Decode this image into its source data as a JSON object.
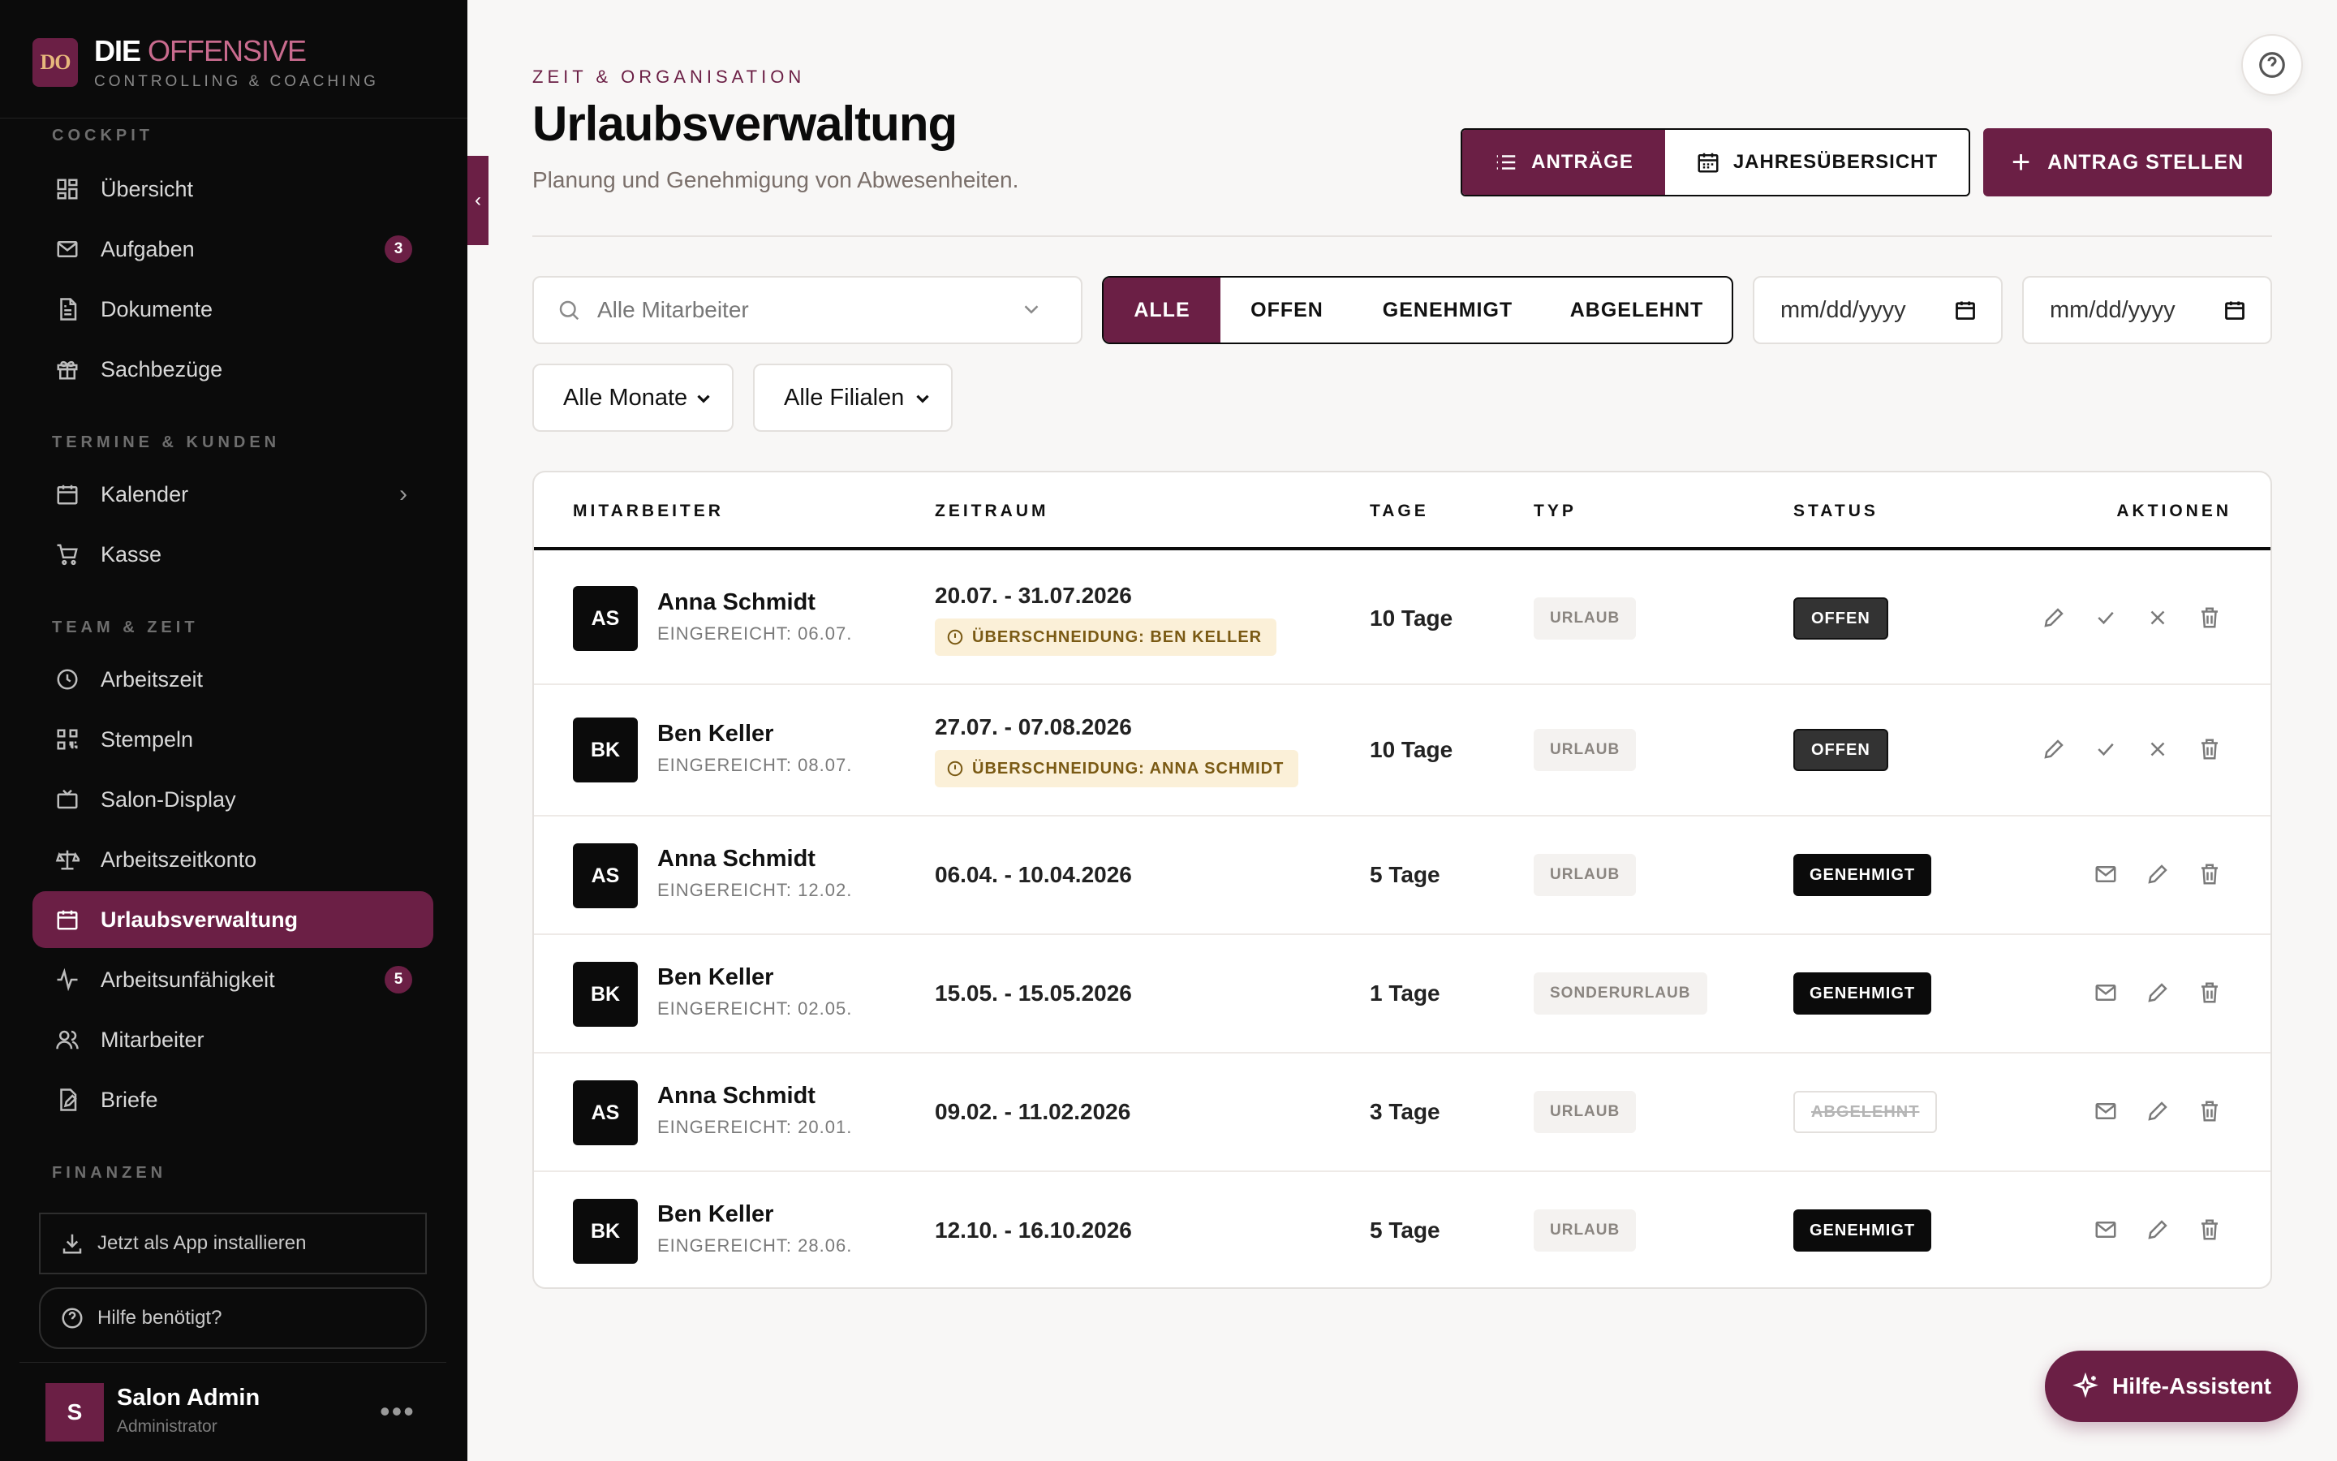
{
  "brand": {
    "logo": "DO",
    "name_part1": "DIE",
    "name_part2": "OFFENSIVE",
    "subtitle": "CONTROLLING & COACHING"
  },
  "sidebar": {
    "sections": [
      {
        "title": "COCKPIT"
      },
      {
        "title": "TERMINE & KUNDEN"
      },
      {
        "title": "TEAM & ZEIT"
      },
      {
        "title": "FINANZEN"
      }
    ],
    "items": [
      {
        "label": "Übersicht",
        "icon": "grid-icon"
      },
      {
        "label": "Aufgaben",
        "icon": "mail-icon",
        "badge": "3"
      },
      {
        "label": "Dokumente",
        "icon": "document-icon"
      },
      {
        "label": "Sachbezüge",
        "icon": "gift-icon"
      },
      {
        "label": "Kalender",
        "icon": "calendar-icon"
      },
      {
        "label": "Kasse",
        "icon": "cart-icon"
      },
      {
        "label": "Arbeitszeit",
        "icon": "clock-icon"
      },
      {
        "label": "Stempeln",
        "icon": "qr-icon"
      },
      {
        "label": "Salon-Display",
        "icon": "tv-icon"
      },
      {
        "label": "Arbeitszeitkonto",
        "icon": "scale-icon"
      },
      {
        "label": "Urlaubsverwaltung",
        "icon": "calendar-icon"
      },
      {
        "label": "Arbeitsunfähigkeit",
        "icon": "activity-icon",
        "badge": "5"
      },
      {
        "label": "Mitarbeiter",
        "icon": "users-icon"
      },
      {
        "label": "Briefe",
        "icon": "edit-icon"
      }
    ],
    "install_label": "Jetzt als App installieren",
    "help_label": "Hilfe benötigt?",
    "user": {
      "initial": "S",
      "name": "Salon Admin",
      "role": "Administrator",
      "more": "•••"
    }
  },
  "header": {
    "eyebrow": "ZEIT & ORGANISATION",
    "title": "Urlaubsverwaltung",
    "subtitle": "Planung und Genehmigung von Abwesenheiten.",
    "view_requests": "ANTRÄGE",
    "view_year": "JAHRESÜBERSICHT",
    "new_request": "ANTRAG STELLEN"
  },
  "filters": {
    "employee_placeholder": "Alle Mitarbeiter",
    "status_tabs": [
      "ALLE",
      "OFFEN",
      "GENEHMIGT",
      "ABGELEHNT"
    ],
    "date_from_placeholder": "mm/dd/yyyy",
    "date_to_placeholder": "mm/dd/yyyy",
    "month_select": "Alle Monate",
    "branch_select": "Alle Filialen"
  },
  "table": {
    "columns": [
      "MITARBEITER",
      "ZEITRAUM",
      "TAGE",
      "TYP",
      "STATUS",
      "AKTIONEN"
    ],
    "rows": [
      {
        "initials": "AS",
        "name": "Anna Schmidt",
        "submitted": "EINGEREICHT: 06.07.",
        "period": "20.07. - 31.07.2026",
        "overlap": "ÜBERSCHNEIDUNG: BEN KELLER",
        "days": "10 Tage",
        "type": "URLAUB",
        "status": "OFFEN"
      },
      {
        "initials": "BK",
        "name": "Ben Keller",
        "submitted": "EINGEREICHT: 08.07.",
        "period": "27.07. - 07.08.2026",
        "overlap": "ÜBERSCHNEIDUNG: ANNA SCHMIDT",
        "days": "10 Tage",
        "type": "URLAUB",
        "status": "OFFEN"
      },
      {
        "initials": "AS",
        "name": "Anna Schmidt",
        "submitted": "EINGEREICHT: 12.02.",
        "period": "06.04. - 10.04.2026",
        "days": "5 Tage",
        "type": "URLAUB",
        "status": "GENEHMIGT"
      },
      {
        "initials": "BK",
        "name": "Ben Keller",
        "submitted": "EINGEREICHT: 02.05.",
        "period": "15.05. - 15.05.2026",
        "days": "1 Tage",
        "type": "SONDERURLAUB",
        "status": "GENEHMIGT"
      },
      {
        "initials": "AS",
        "name": "Anna Schmidt",
        "submitted": "EINGEREICHT: 20.01.",
        "period": "09.02. - 11.02.2026",
        "days": "3 Tage",
        "type": "URLAUB",
        "status": "ABGELEHNT"
      },
      {
        "initials": "BK",
        "name": "Ben Keller",
        "submitted": "EINGEREICHT: 28.06.",
        "period": "12.10. - 16.10.2026",
        "days": "5 Tage",
        "type": "URLAUB",
        "status": "GENEHMIGT"
      }
    ]
  },
  "assistant": {
    "label": "Hilfe-Assistent"
  },
  "colors": {
    "brand": "#6b1f45",
    "overlap_bg": "#fbf0d8",
    "sidebar_bg": "#0b0b0b"
  }
}
